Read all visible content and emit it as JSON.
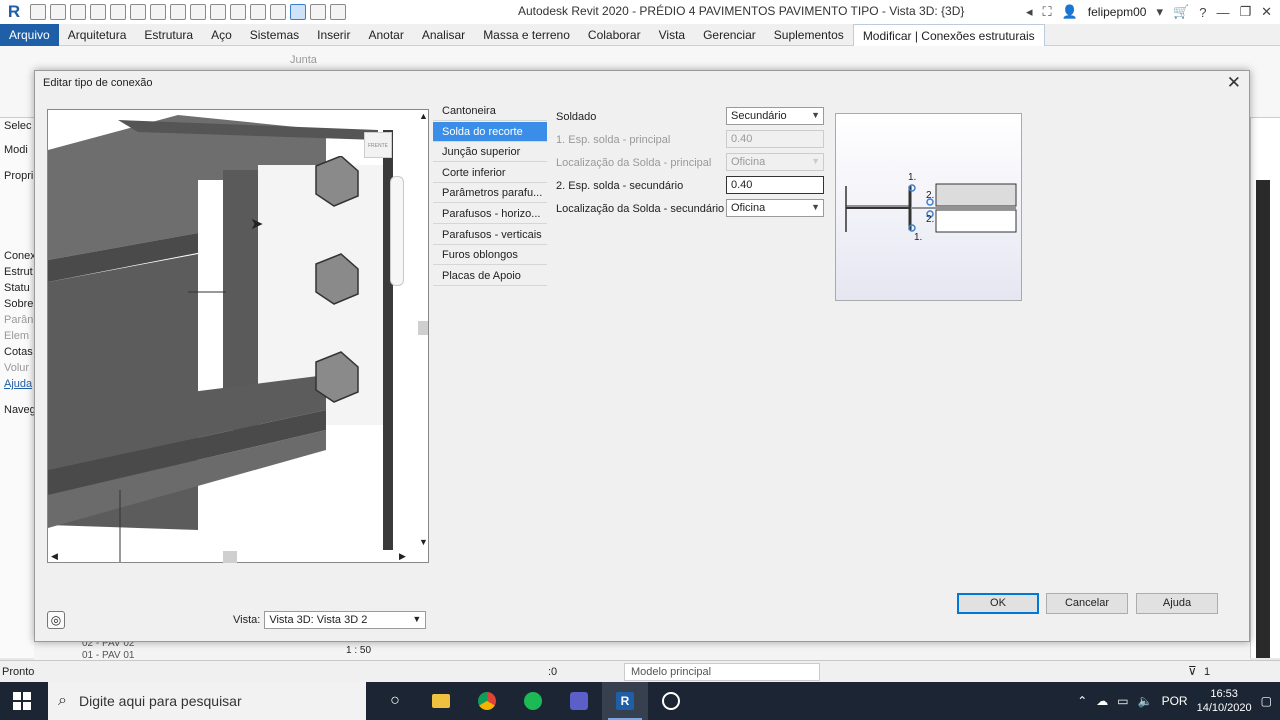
{
  "app": {
    "title": "Autodesk Revit 2020 - PRÉDIO 4 PAVIMENTOS PAVIMENTO TIPO - Vista 3D: {3D}",
    "user": "felipepm00",
    "logo": "R"
  },
  "ribbon_tabs": [
    "Arquivo",
    "Arquitetura",
    "Estrutura",
    "Aço",
    "Sistemas",
    "Inserir",
    "Anotar",
    "Analisar",
    "Massa e terreno",
    "Colaborar",
    "Vista",
    "Gerenciar",
    "Suplementos",
    "Modificar | Conexões estruturais"
  ],
  "ribbon": {
    "junta_label": "Junta"
  },
  "left_panel": [
    "Selec",
    "Modi",
    "Propri",
    "Conex",
    "Estrut",
    "Statu",
    "Sobre",
    "Parân",
    "Elem",
    "Cotas",
    "Volur",
    "Ajuda",
    "Naveg"
  ],
  "dialog": {
    "title": "Editar tipo de conexão",
    "nav_items": [
      "Cantoneira",
      "Solda do recorte",
      "Junção superior",
      "Corte inferior",
      "Parâmetros parafu...",
      "Parafusos - horizo...",
      "Parafusos - verticais",
      "Furos oblongos",
      "Placas de Apoio"
    ],
    "selected_nav": 1,
    "properties": {
      "section": "Soldado",
      "section_value": "Secundário",
      "rows": [
        {
          "label": "1. Esp. solda - principal",
          "value": "0.40",
          "disabled": true,
          "dropdown": false
        },
        {
          "label": "Localização da Solda - principal",
          "value": "Oficina",
          "disabled": true,
          "dropdown": true
        },
        {
          "label": "2. Esp. solda - secundário",
          "value": "0.40",
          "disabled": false,
          "dropdown": false
        },
        {
          "label": "Localização da Solda - secundário",
          "value": "Oficina",
          "disabled": false,
          "dropdown": true
        }
      ]
    },
    "preview_labels": {
      "l1_top": "1.",
      "l2_top": "2.",
      "l2_bot": "2.",
      "l1_bot": "1."
    },
    "view_cube_label": "FRENTE",
    "vista_label": "Vista:",
    "vista_value": "Vista 3D: Vista 3D 2",
    "buttons": {
      "ok": "OK",
      "cancel": "Cancelar",
      "help": "Ajuda"
    }
  },
  "below_dialog": {
    "tree_a": "02 - PAV 02",
    "tree_b": "01 - PAV 01",
    "scale": "1 : 50"
  },
  "status": {
    "text": "Pronto",
    "filter_count": ":0",
    "model": "Modelo principal",
    "filter_value": "1"
  },
  "taskbar": {
    "search_placeholder": "Digite aqui para pesquisar",
    "language": "POR",
    "time": "16:53",
    "date": "14/10/2020"
  }
}
